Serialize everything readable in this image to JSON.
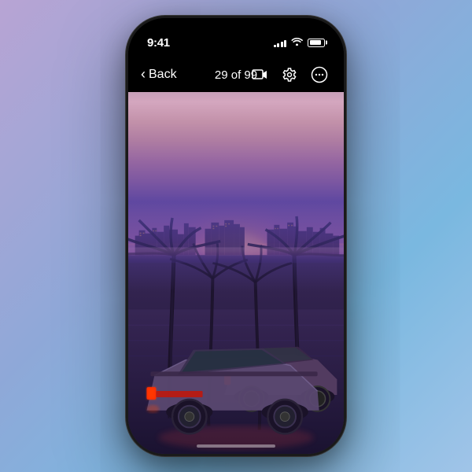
{
  "background": {
    "gradient": "linear-gradient(135deg, #b8a4d4, #8fa8d8, #7ab8e0)"
  },
  "phone": {
    "status_bar": {
      "time": "9:41",
      "signal_label": "signal",
      "wifi_label": "wifi",
      "battery_label": "battery"
    },
    "nav_bar": {
      "back_label": "Back",
      "counter": "29 of 99",
      "action1_label": "slideshow",
      "action2_label": "settings",
      "action3_label": "more"
    },
    "image": {
      "description": "Synthwave retrowave scene with sports car, palm trees, and city skyline at dusk"
    },
    "home_indicator": "home"
  }
}
